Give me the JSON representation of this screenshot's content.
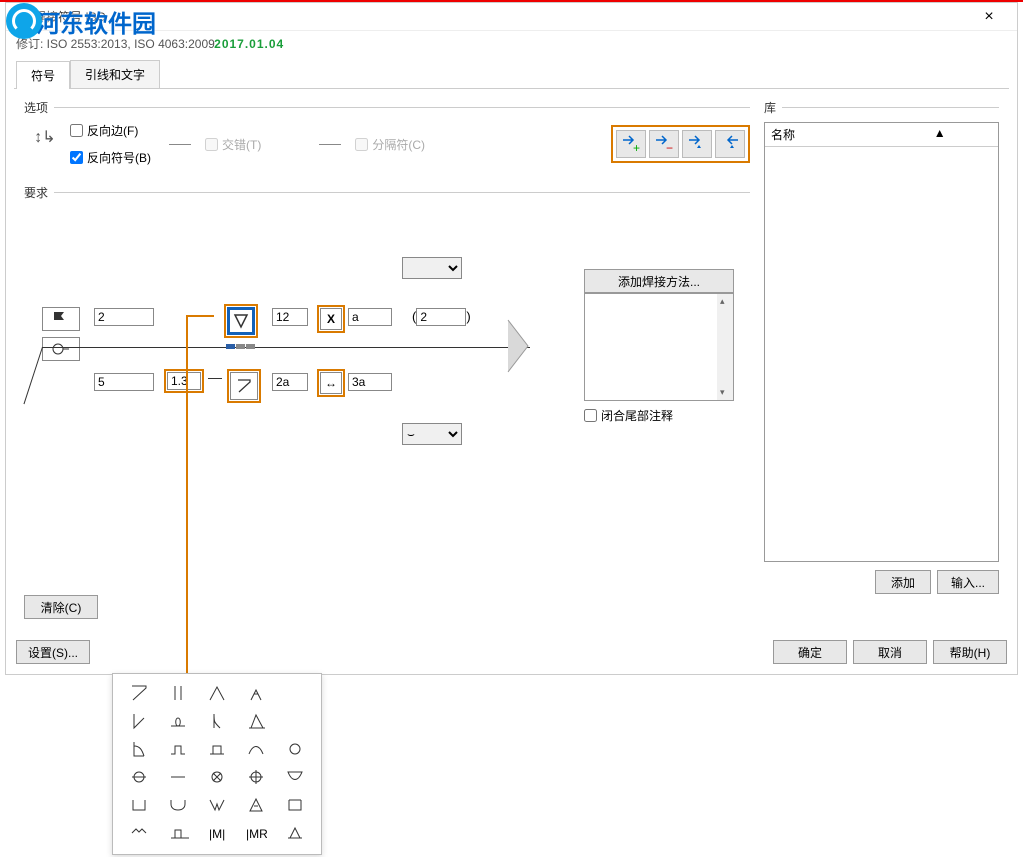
{
  "window": {
    "title": "焊接符号 ISO",
    "subtitle_prefix": "修订: ISO 2553:2013, ISO 4063:2009",
    "watermark_text": "河东软件园",
    "watermark_sub": "2017.01.04"
  },
  "tabs": {
    "t1": "符号",
    "t2": "引线和文字"
  },
  "options": {
    "section": "选项",
    "reverse_side": "反向边(F)",
    "reverse_symbol": "反向符号(B)",
    "stagger": "交错(T)",
    "separator": "分隔符(C)"
  },
  "requirements": {
    "section": "要求"
  },
  "fields": {
    "top_left": "2",
    "top_size": "12",
    "top_mult": "X",
    "top_pitch": "a",
    "top_group": "2",
    "bot_left": "5",
    "bot_depth": "1.3",
    "bot_size": "2a",
    "bot_pitch": "3a"
  },
  "weld_method": {
    "button": "添加焊接方法...",
    "close_tail": "闭合尾部注释"
  },
  "library": {
    "section": "库",
    "header": "名称",
    "add": "添加",
    "import": "输入..."
  },
  "buttons": {
    "clear": "清除(C)",
    "settings": "设置(S)...",
    "ok": "确定",
    "cancel": "取消",
    "help": "帮助(H)"
  },
  "icons": {
    "lib1": "add-to-lib",
    "lib2": "remove-from-lib",
    "lib3": "update-lib",
    "lib4": "apply-lib"
  }
}
